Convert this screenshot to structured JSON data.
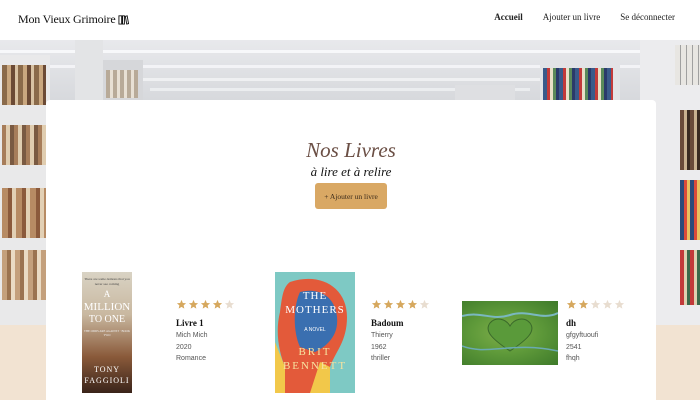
{
  "header": {
    "logo_text": "Mon Vieux Grimoire",
    "nav": [
      "Accueil",
      "Ajouter un livre",
      "Se déconnecter"
    ]
  },
  "main": {
    "title": "Nos Livres",
    "subtitle": "à lire et à relire",
    "add_button": "+ Ajouter un livre"
  },
  "books": [
    {
      "rating": 4,
      "title": "Livre 1",
      "author": "Mich Mich",
      "year": "2020",
      "genre": "Romance",
      "cover": {
        "line1": "There are some demons that you",
        "line2": "never see coming",
        "big1": "A",
        "big2": "MILLION",
        "big3": "TO ONE",
        "series": "THE ODDS ARE AGAINST · BOOK TWO",
        "author_first": "TONY",
        "author_last": "FAGGIOLI"
      }
    },
    {
      "rating": 4,
      "title": "Badoum",
      "author": "Thierry",
      "year": "1962",
      "genre": "thriller",
      "cover": {
        "word1": "THE",
        "word2": "MOTHERS",
        "novel": "A NOVEL",
        "author1": "BRIT",
        "author2": "BENNETT"
      }
    },
    {
      "rating": 2,
      "title": "dh",
      "author": "gfgyftuoufi",
      "year": "2541",
      "genre": "fhqh",
      "cover": {}
    }
  ],
  "colors": {
    "accent_button": "#d9a864",
    "title_color": "#6b4f45",
    "star_filled": "#d6a85e",
    "star_empty": "#e8ddd0",
    "beige": "#f2e3d2"
  }
}
